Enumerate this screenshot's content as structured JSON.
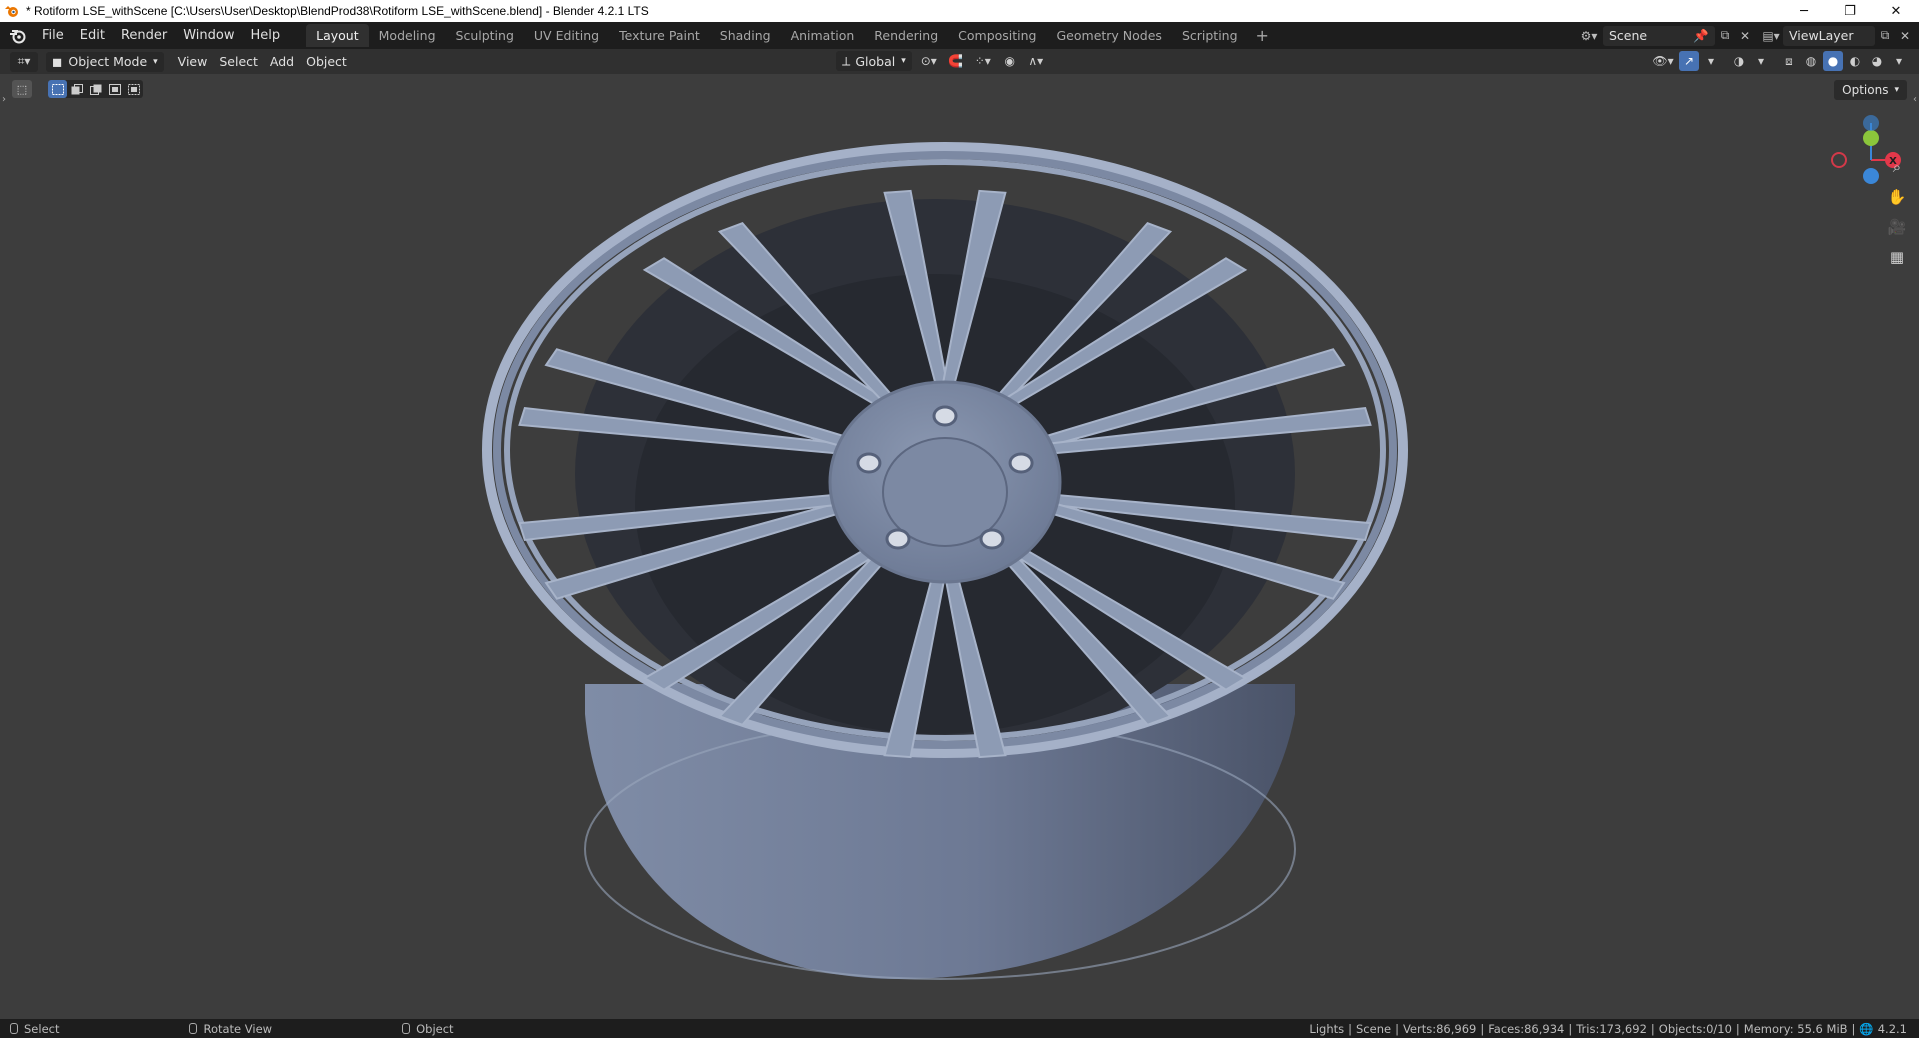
{
  "window": {
    "title": "* Rotiform LSE_withScene [C:\\Users\\User\\Desktop\\BlendProd38\\Rotiform LSE_withScene.blend] - Blender 4.2.1 LTS",
    "minimize": "─",
    "restore": "❐",
    "close": "✕"
  },
  "menu": [
    "File",
    "Edit",
    "Render",
    "Window",
    "Help"
  ],
  "workspaces": [
    "Layout",
    "Modeling",
    "Sculpting",
    "UV Editing",
    "Texture Paint",
    "Shading",
    "Animation",
    "Rendering",
    "Compositing",
    "Geometry Nodes",
    "Scripting"
  ],
  "active_workspace": "Layout",
  "workspace_add": "+",
  "scene": {
    "name": "Scene"
  },
  "view_layer": {
    "name": "ViewLayer"
  },
  "viewport_header": {
    "mode": "Object Mode",
    "menus": [
      "View",
      "Select",
      "Add",
      "Object"
    ],
    "orientation": "Global"
  },
  "options_label": "Options",
  "gizmo": {
    "x": "X",
    "y": "Y",
    "z": "Z"
  },
  "status": {
    "hints": [
      "Select",
      "Rotate View",
      "Object"
    ],
    "stats": [
      "Lights",
      "Scene",
      "Verts:86,969",
      "Faces:86,934",
      "Tris:173,692",
      "Objects:0/10",
      "Memory: 55.6 MiB",
      "4.2.1"
    ]
  },
  "colors": {
    "wheel_surface": "#8d9bb4",
    "viewport_bg": "#3d3d3d",
    "active_blue": "#4772b3",
    "axis_x": "#e2384a",
    "axis_y": "#8bc63b",
    "axis_z": "#3b87d8"
  }
}
